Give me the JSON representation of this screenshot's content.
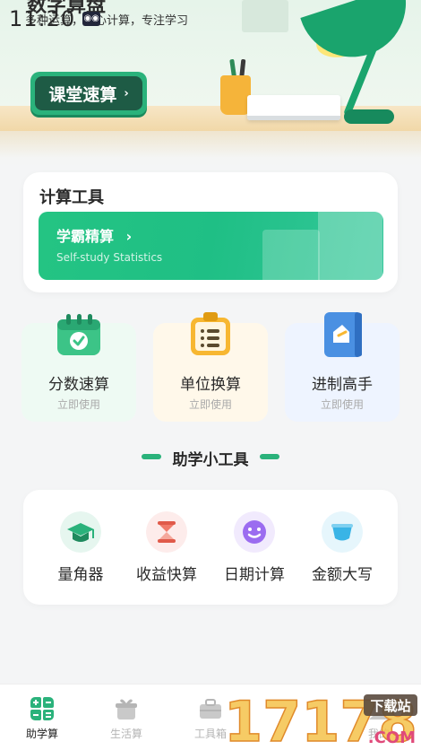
{
  "status": {
    "time": "11:20"
  },
  "header": {
    "app_name": "数字算盘",
    "subtitle": "多种运算，随心计算，专注学习",
    "course_label": "课堂速算",
    "course_chevron": "›"
  },
  "calc_tools": {
    "title": "计算工具",
    "banner_title": "学霸精算",
    "banner_chevron": "›",
    "banner_subtitle": "Self-study Statistics"
  },
  "tool_cards": [
    {
      "name": "分数速算",
      "action": "立即使用",
      "icon": "calendar-check-icon",
      "bg": "#eefaf3",
      "icon_color": "#3cc487"
    },
    {
      "name": "单位换算",
      "action": "立即使用",
      "icon": "clipboard-list-icon",
      "bg": "#fff8ea",
      "icon_color": "#f7b731"
    },
    {
      "name": "进制高手",
      "action": "立即使用",
      "icon": "notebook-icon",
      "bg": "#eef4ff",
      "icon_color": "#4a90e2"
    }
  ],
  "helper_section": {
    "title": "助学小工具"
  },
  "helper_tools": [
    {
      "label": "量角器",
      "icon": "graduation-cap-icon",
      "color": "#2ab27b",
      "bg": "#e6f6ef"
    },
    {
      "label": "收益快算",
      "icon": "hourglass-icon",
      "color": "#f07a6a",
      "bg": "#fdeceb"
    },
    {
      "label": "日期计算",
      "icon": "smiley-icon",
      "color": "#9b6cf0",
      "bg": "#f1eafd"
    },
    {
      "label": "金额大写",
      "icon": "cup-icon",
      "color": "#39b4e6",
      "bg": "#e6f6fc"
    }
  ],
  "bottom_nav": [
    {
      "label": "助学算",
      "icon": "calculator-icon",
      "active": true
    },
    {
      "label": "生活算",
      "icon": "gift-icon",
      "active": false
    },
    {
      "label": "工具箱",
      "icon": "toolbox-icon",
      "active": false
    },
    {
      "label": "我的",
      "icon": "user-icon",
      "active": false
    }
  ],
  "watermark": {
    "number": "17178",
    "tag": "下载站",
    "domain": ".COM"
  }
}
